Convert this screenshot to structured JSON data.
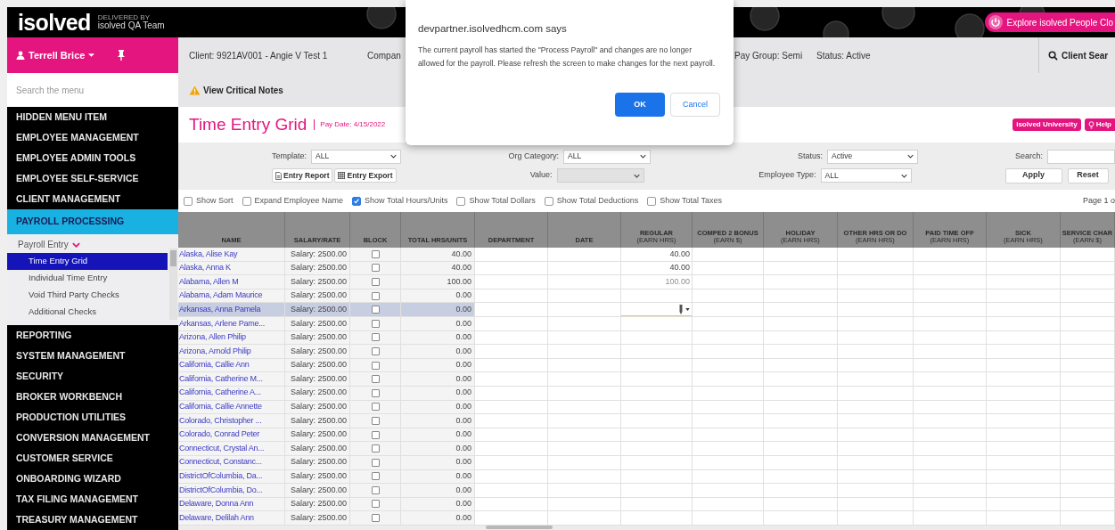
{
  "header": {
    "logo": "isolved",
    "delivered_by": "DELIVERED BY",
    "team": "isolved QA Team",
    "explore_button": "Explore isolved People Clo"
  },
  "user": {
    "name": "Terrell Brice"
  },
  "menu_search": {
    "placeholder": "Search the menu"
  },
  "info_bar": {
    "client": "Client: 9921AV001 - Angie V Test 1",
    "company": "Compan",
    "pay_group": "Pay Group: Semi",
    "status": "Status: Active",
    "client_search": "Client Sear"
  },
  "critical_notes": "View Critical Notes",
  "sidebar": {
    "items": [
      {
        "label": "HIDDEN MENU ITEM",
        "selected": false
      },
      {
        "label": "EMPLOYEE MANAGEMENT",
        "selected": false
      },
      {
        "label": "EMPLOYEE ADMIN TOOLS",
        "selected": false
      },
      {
        "label": "EMPLOYEE SELF-SERVICE",
        "selected": false
      },
      {
        "label": "CLIENT MANAGEMENT",
        "selected": false
      },
      {
        "label": "PAYROLL PROCESSING",
        "selected": true,
        "children": [
          {
            "label": "Payroll Entry",
            "expanded": true,
            "children": [
              {
                "label": "Time Entry Grid",
                "selected": true
              },
              {
                "label": "Individual Time Entry",
                "selected": false
              },
              {
                "label": "Void Third Party Checks",
                "selected": false
              },
              {
                "label": "Additional Checks",
                "selected": false
              }
            ]
          }
        ]
      },
      {
        "label": "REPORTING",
        "selected": false
      },
      {
        "label": "SYSTEM MANAGEMENT",
        "selected": false
      },
      {
        "label": "SECURITY",
        "selected": false
      },
      {
        "label": "BROKER WORKBENCH",
        "selected": false
      },
      {
        "label": "PRODUCTION UTILITIES",
        "selected": false
      },
      {
        "label": "CONVERSION MANAGEMENT",
        "selected": false
      },
      {
        "label": "CUSTOMER SERVICE",
        "selected": false
      },
      {
        "label": "ONBOARDING WIZARD",
        "selected": false
      },
      {
        "label": "TAX FILING MANAGEMENT",
        "selected": false
      },
      {
        "label": "TREASURY MANAGEMENT",
        "selected": false
      }
    ]
  },
  "page": {
    "title": "Time Entry Grid",
    "pay_date": "Pay Date: 4/15/2022",
    "university_button": "isolved University",
    "help_button": "Help"
  },
  "filters": {
    "template": {
      "label": "Template:",
      "value": "ALL"
    },
    "org_category": {
      "label": "Org Category:",
      "value": "ALL"
    },
    "value": {
      "label": "Value:",
      "disabled": true
    },
    "status": {
      "label": "Status:",
      "value": "Active"
    },
    "employee_type": {
      "label": "Employee Type:",
      "value": "ALL"
    },
    "search": {
      "label": "Search:"
    },
    "entry_buttons": [
      "Entry Report",
      "Entry Export"
    ],
    "action_buttons": [
      "Apply",
      "Reset"
    ]
  },
  "options": [
    {
      "label": "Show Sort",
      "checked": false
    },
    {
      "label": "Expand Employee Name",
      "checked": false
    },
    {
      "label": "Show Total Hours/Units",
      "checked": true
    },
    {
      "label": "Show Total Dollars",
      "checked": false
    },
    {
      "label": "Show Total Deductions",
      "checked": false
    },
    {
      "label": "Show Total Taxes",
      "checked": false
    }
  ],
  "pagination": "Page 1 o",
  "table": {
    "columns": [
      {
        "title": "NAME"
      },
      {
        "title": "SALARY/RATE"
      },
      {
        "title": "BLOCK"
      },
      {
        "title": "TOTAL HRS/UNITS"
      },
      {
        "title": "DEPARTMENT"
      },
      {
        "title": "DATE"
      },
      {
        "title": "REGULAR",
        "subtitle": "(EARN HRS)"
      },
      {
        "title": "COMPED 2 BONUS",
        "subtitle": "(EARN $)"
      },
      {
        "title": "HOLIDAY",
        "subtitle": "(EARN HRS)"
      },
      {
        "title": "OTHER HRS OR DO",
        "subtitle": "(EARN HRS)"
      },
      {
        "title": "PAID TIME OFF",
        "subtitle": "(EARN HRS)"
      },
      {
        "title": "SICK",
        "subtitle": "(EARN HRS)"
      },
      {
        "title": "SERVICE CHAR",
        "subtitle": "(EARN $)"
      }
    ],
    "rows": [
      {
        "name": "Alaska, Alise Kay",
        "salary": "Salary: 2500.00",
        "block": false,
        "total": "40.00",
        "regular": {
          "value": "40.00",
          "disabled": false
        },
        "selected": false
      },
      {
        "name": "Alaska, Anna K",
        "salary": "Salary: 2500.00",
        "block": false,
        "total": "40.00",
        "regular": {
          "value": "40.00",
          "disabled": false
        },
        "selected": false
      },
      {
        "name": "Alabama, Allen M",
        "salary": "Salary: 2500.00",
        "block": false,
        "total": "100.00",
        "regular": {
          "value": "100.00",
          "disabled": true
        },
        "selected": false
      },
      {
        "name": "Alabama, Adam Maurice",
        "salary": "Salary: 2500.00",
        "block": false,
        "total": "0.00",
        "selected": false
      },
      {
        "name": "Arkansas, Anna Pamela",
        "salary": "Salary: 2500.00",
        "block": false,
        "total": "0.00",
        "selected": true
      },
      {
        "name": "Arkansas, Arlene Pame...",
        "salary": "Salary: 2500.00",
        "block": false,
        "total": "0.00",
        "selected": false
      },
      {
        "name": "Arizona, Allen Philip",
        "salary": "Salary: 2500.00",
        "block": false,
        "total": "0.00",
        "selected": false
      },
      {
        "name": "Arizona, Arnold Philip",
        "salary": "Salary: 2500.00",
        "block": false,
        "total": "0.00",
        "selected": false
      },
      {
        "name": "California, Callie Ann",
        "salary": "Salary: 2500.00",
        "block": false,
        "total": "0.00",
        "selected": false
      },
      {
        "name": "California, Catherine M...",
        "salary": "Salary: 2500.00",
        "block": false,
        "total": "0.00",
        "selected": false
      },
      {
        "name": "California, Catherine A...",
        "salary": "Salary: 2500.00",
        "block": false,
        "total": "0.00",
        "selected": false
      },
      {
        "name": "California, Callie Annette",
        "salary": "Salary: 2500.00",
        "block": false,
        "total": "0.00",
        "selected": false
      },
      {
        "name": "Colorado, Christopher ...",
        "salary": "Salary: 2500.00",
        "block": false,
        "total": "0.00",
        "selected": false
      },
      {
        "name": "Colorado, Conrad Peter",
        "salary": "Salary: 2500.00",
        "block": false,
        "total": "0.00",
        "selected": false
      },
      {
        "name": "Connecticut, Crystal An...",
        "salary": "Salary: 2500.00",
        "block": false,
        "total": "0.00",
        "selected": false
      },
      {
        "name": "Connecticut, Constanc...",
        "salary": "Salary: 2500.00",
        "block": false,
        "total": "0.00",
        "selected": false
      },
      {
        "name": "DistrictOfColumbia, Da...",
        "salary": "Salary: 2500.00",
        "block": false,
        "total": "0.00",
        "selected": false
      },
      {
        "name": "DistrictOfColumbia, Do...",
        "salary": "Salary: 2500.00",
        "block": false,
        "total": "0.00",
        "selected": false
      },
      {
        "name": "Delaware, Donna Ann",
        "salary": "Salary: 2500.00",
        "block": false,
        "total": "0.00",
        "selected": false
      },
      {
        "name": "Delaware, Delilah Ann",
        "salary": "Salary: 2500.00",
        "block": false,
        "total": "0.00",
        "selected": false
      }
    ]
  },
  "dialog": {
    "origin": "devpartner.isolvedhcm.com says",
    "message": "The current payroll has started the \"Process Payroll\" and changes are no longer allowed for the payroll. Please refresh the screen to make changes for the next payroll.",
    "buttons": [
      "OK",
      "Cancel"
    ]
  }
}
